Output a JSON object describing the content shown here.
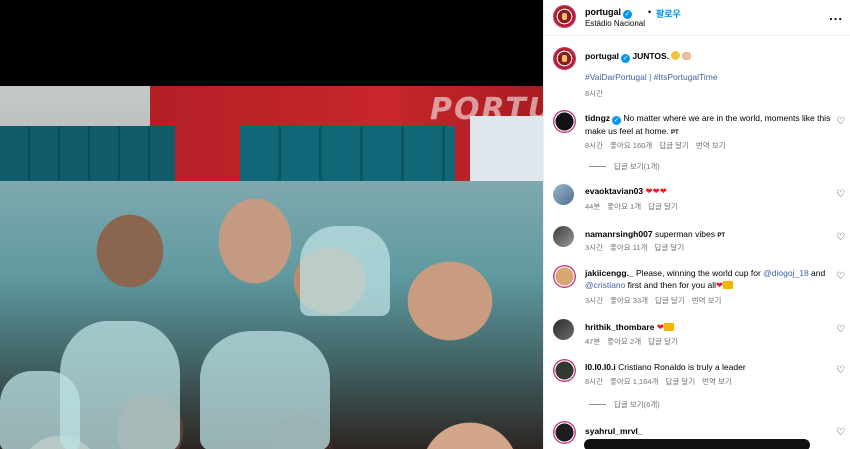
{
  "header": {
    "username": "portugal",
    "follow_label": "팔로우",
    "location": "Estádio Nacional",
    "separator": "•",
    "more_icon": "..."
  },
  "caption": {
    "username": "portugal",
    "text": "JUNTOS.",
    "hashtags": "#VaiDarPortugal | #ItsPortugalTime",
    "time": "8시간"
  },
  "photo": {
    "wall_text": "PORTUGAL"
  },
  "comments": [
    {
      "username": "tidngz",
      "text": "No matter where we are in the world, moments like this make us feel at home.",
      "badge": "PT",
      "meta": [
        "8시간",
        "좋아요 160개",
        "답글 달기",
        "번역 보기"
      ],
      "replies": "답글 보기(1개)"
    },
    {
      "username": "evaoktavian03",
      "text": "",
      "meta": [
        "44분",
        "좋아요 1개",
        "답글 달기"
      ]
    },
    {
      "username": "namanrsingh007",
      "text": "superman vibes",
      "badge": "PT",
      "meta": [
        "3시간",
        "좋아요 11개",
        "답글 달기"
      ]
    },
    {
      "username": "jakiicengg._",
      "text_pre": "Please, winning the world cup for",
      "mention1": "@diogoj_18",
      "text_mid": "and",
      "mention2": "@cristiano",
      "text_post": "first and then for you all",
      "meta": [
        "3시간",
        "좋아요 33개",
        "답글 달기",
        "번역 보기"
      ]
    },
    {
      "username": "hrithik_thombare",
      "text": "",
      "meta": [
        "47분",
        "좋아요 2개",
        "답글 달기"
      ]
    },
    {
      "username": "l0.l0.l0.i",
      "text": "Cristiano Ronaldo is truly a leader",
      "meta": [
        "8시간",
        "좋아요 1,164개",
        "답글 달기",
        "번역 보기"
      ],
      "replies": "답글 보기(6개)"
    },
    {
      "username": "syahrul_mrvl_",
      "text": ""
    }
  ]
}
